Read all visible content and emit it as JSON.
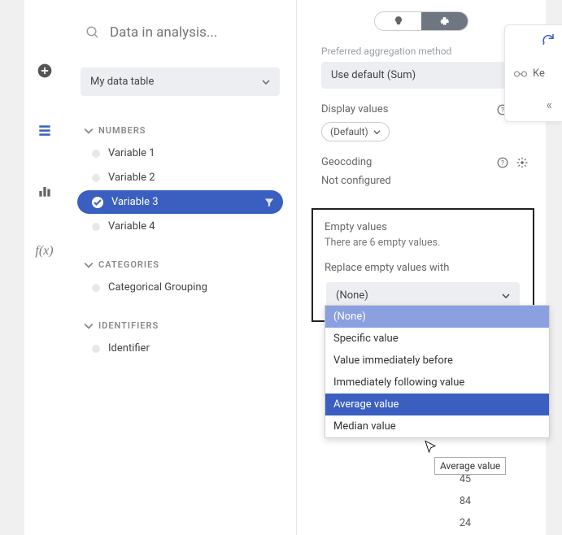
{
  "search": {
    "placeholder": "Data in analysis..."
  },
  "tableSelect": {
    "label": "My data table"
  },
  "groups": {
    "numbers": {
      "header": "NUMBERS",
      "items": [
        "Variable 1",
        "Variable 2",
        "Variable 3",
        "Variable 4"
      ],
      "selectedIndex": 2
    },
    "categories": {
      "header": "CATEGORIES",
      "items": [
        "Categorical Grouping"
      ]
    },
    "identifiers": {
      "header": "IDENTIFIERS",
      "items": [
        "Identifier"
      ]
    }
  },
  "prop": {
    "aggLabel": "Preferred aggregation method",
    "aggValue": "Use default (Sum)",
    "displayLabel": "Display values",
    "displayValue": "(Default)",
    "geoLabel": "Geocoding",
    "geoStatus": "Not configured"
  },
  "empty": {
    "title": "Empty values",
    "countLine": "There are 6 empty values.",
    "replaceLabel": "Replace empty values with",
    "current": "(None)",
    "options": [
      "(None)",
      "Specific value",
      "Value immediately before",
      "Immediately following value",
      "Average value",
      "Median value"
    ],
    "hoverIndex": 4,
    "tooltip": "Average value"
  },
  "sideValues": [
    "45",
    "84",
    "24"
  ],
  "strip": {
    "key": "Ke"
  }
}
